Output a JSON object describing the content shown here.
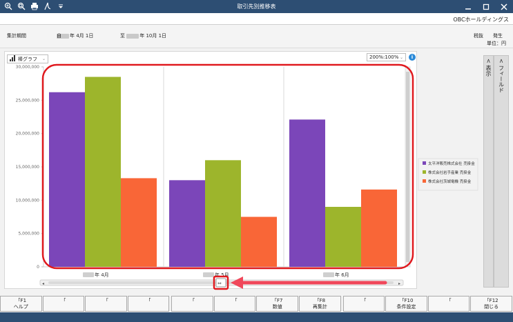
{
  "window": {
    "title": "取引先別推移表",
    "controls": [
      "minimize-icon",
      "maximize-icon",
      "close-icon"
    ],
    "toolbar_icons": [
      "zoom-in-icon",
      "zoom-fit-icon",
      "print-icon",
      "pdf-icon",
      "dropdown-arrow-icon"
    ]
  },
  "company": "OBCホールディングス",
  "period": {
    "label": "集計期間",
    "from_prefix": "自",
    "from_value": "年  4月 1日",
    "to_prefix": "至",
    "to_value": "年 10月 1日",
    "tax_label": "税抜",
    "basis_label": "発生",
    "unit_label": "単位：円"
  },
  "controls": {
    "chart_type_label": "棒グラフ",
    "zoom_value": "200%:100%",
    "info_icon": "i"
  },
  "sidebar": {
    "show_label": "< 表示",
    "field_label": "< フィールド"
  },
  "colors": {
    "titlebar": "#2d4e73",
    "series1": "#7b46b9",
    "series2": "#9db52c",
    "series3": "#f96637",
    "highlight": "#e0191e",
    "arrow": "#f0485b"
  },
  "chart_data": {
    "type": "bar",
    "categories": [
      "年  4月",
      "年  5月",
      "年  6月"
    ],
    "series": [
      {
        "name": "太平洋販売株式会社 売掛金",
        "values": [
          26200000,
          13000000,
          22100000
        ]
      },
      {
        "name": "株式会社岩手産業 売掛金",
        "values": [
          28500000,
          16000000,
          9000000
        ]
      },
      {
        "name": "株式会社茨城電機 売掛金",
        "values": [
          13300000,
          7500000,
          11600000
        ]
      }
    ],
    "yticks": [
      "0",
      "5,000,000",
      "10,000,000",
      "15,000,000",
      "20,000,000",
      "25,000,000",
      "30,000,000"
    ],
    "ylim": [
      0,
      30000000
    ],
    "grid": true,
    "legend": "right"
  },
  "function_keys": [
    {
      "key": "F1",
      "label": "ヘルプ"
    },
    {
      "key": "",
      "label": ""
    },
    {
      "key": "",
      "label": ""
    },
    {
      "key": "",
      "label": ""
    },
    {
      "key": "",
      "label": ""
    },
    {
      "key": "",
      "label": ""
    },
    {
      "key": "F7",
      "label": "数値"
    },
    {
      "key": "F8",
      "label": "再集計"
    },
    {
      "key": "",
      "label": ""
    },
    {
      "key": "F10",
      "label": "条件設定"
    },
    {
      "key": "",
      "label": ""
    },
    {
      "key": "F12",
      "label": "閉じる"
    }
  ]
}
